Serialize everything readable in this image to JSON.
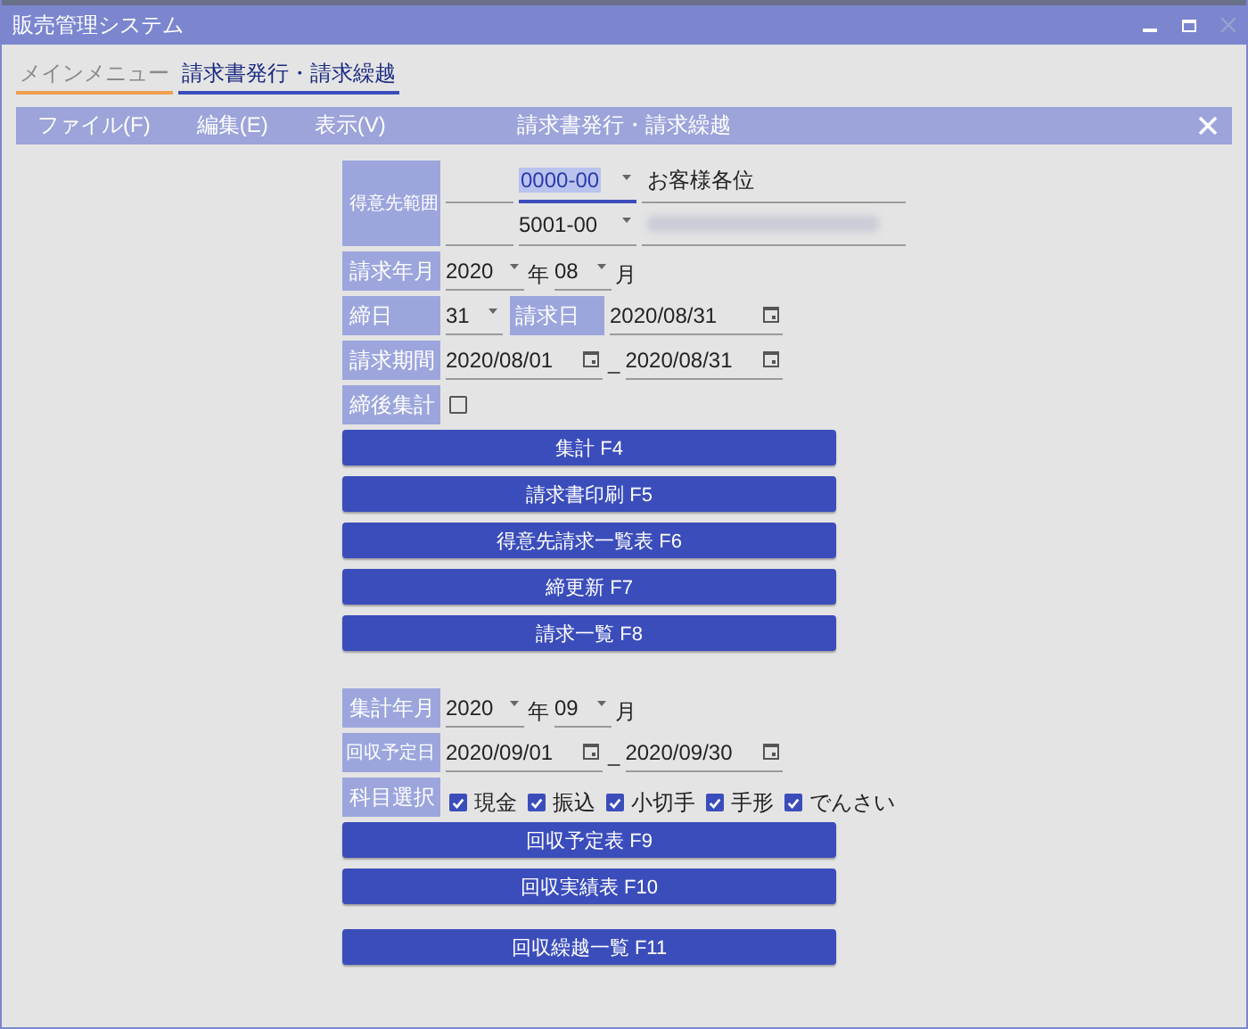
{
  "window": {
    "title": "販売管理システム"
  },
  "tabs": [
    {
      "label": "メインメニュー",
      "selected": false
    },
    {
      "label": "請求書発行・請求繰越",
      "selected": true
    }
  ],
  "menu": {
    "items": [
      "ファイル(F)",
      "編集(E)",
      "表示(V)"
    ],
    "title": "請求書発行・請求繰越"
  },
  "billing": {
    "customer_range": {
      "label": "得意先範囲",
      "rows": [
        {
          "code": "0000-00",
          "selected": true,
          "name": "お客様各位",
          "redacted": false
        },
        {
          "code": "5001-00",
          "selected": false,
          "redacted": true
        }
      ]
    },
    "year_month": {
      "label": "請求年月",
      "year": "2020",
      "year_unit": "年",
      "month": "08",
      "month_unit": "月"
    },
    "closing": {
      "label": "締日",
      "day": "31",
      "date_label": "請求日",
      "date": "2020/08/31"
    },
    "period": {
      "label": "請求期間",
      "from": "2020/08/01",
      "separator": "_",
      "to": "2020/08/31"
    },
    "post_close": {
      "label": "締後集計",
      "checked": false
    },
    "button_groups": [
      [
        "集計 F4",
        "請求書印刷 F5",
        "得意先請求一覧表 F6",
        "締更新 F7",
        "請求一覧 F8"
      ]
    ]
  },
  "collection": {
    "year_month": {
      "label": "集計年月",
      "year": "2020",
      "year_unit": "年",
      "month": "09",
      "month_unit": "月"
    },
    "due_dates": {
      "label": "回収予定日",
      "from": "2020/09/01",
      "separator": "_",
      "to": "2020/09/30"
    },
    "subjects": {
      "label": "科目選択",
      "options": [
        {
          "label": "現金",
          "checked": true
        },
        {
          "label": "振込",
          "checked": true
        },
        {
          "label": "小切手",
          "checked": true
        },
        {
          "label": "手形",
          "checked": true
        },
        {
          "label": "でんさい",
          "checked": true
        }
      ]
    },
    "button_groups": [
      [
        "回収予定表 F9",
        "回収実績表 F10"
      ],
      [
        "回収繰越一覧 F11"
      ]
    ]
  }
}
